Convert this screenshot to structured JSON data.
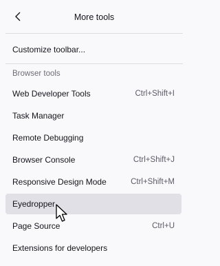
{
  "header": {
    "title": "More tools",
    "back_icon": "chevron-left-icon"
  },
  "customize": {
    "label": "Customize toolbar..."
  },
  "browser_tools": {
    "section_label": "Browser tools",
    "items": [
      {
        "label": "Web Developer Tools",
        "shortcut": "Ctrl+Shift+I"
      },
      {
        "label": "Task Manager",
        "shortcut": ""
      },
      {
        "label": "Remote Debugging",
        "shortcut": ""
      },
      {
        "label": "Browser Console",
        "shortcut": "Ctrl+Shift+J"
      },
      {
        "label": "Responsive Design Mode",
        "shortcut": "Ctrl+Shift+M"
      },
      {
        "label": "Eyedropper",
        "shortcut": ""
      },
      {
        "label": "Page Source",
        "shortcut": "Ctrl+U"
      },
      {
        "label": "Extensions for developers",
        "shortcut": ""
      }
    ]
  },
  "state": {
    "hovered_item": "Eyedropper"
  },
  "colors": {
    "background": "#f9f9fb",
    "hover": "#e0e0e6",
    "text": "#15141a",
    "muted": "#6d6d75"
  }
}
